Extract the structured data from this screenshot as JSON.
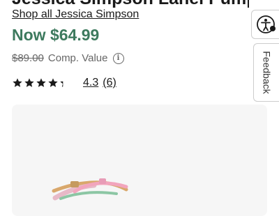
{
  "product": {
    "title": "Jessica Simpson Lanel Pump",
    "brand_link": "Shop all Jessica Simpson",
    "price_now": "Now $64.99",
    "price_original": "$89.00",
    "comp_label": "Comp. Value",
    "info_icon": "info-icon",
    "rating": 4.3,
    "rating_text": "4.3",
    "review_count": "(6)",
    "stars_filled": 4.3,
    "stars_total": 5
  },
  "side_tools": {
    "accessibility_icon": "accessibility-icon",
    "feedback_label": "Feedback"
  },
  "colors": {
    "price_green": "#3d7a5e",
    "image_bg": "#f6f6f6"
  }
}
